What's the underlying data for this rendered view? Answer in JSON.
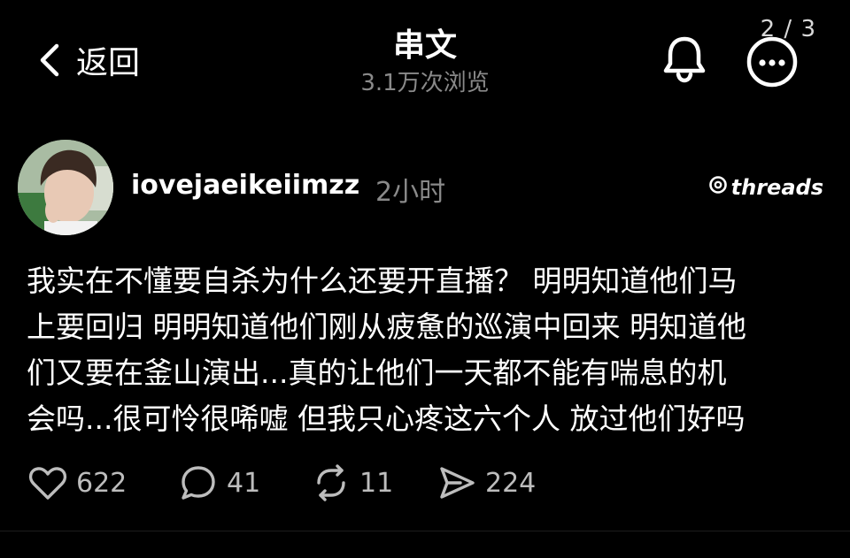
{
  "page_counter": "2 / 3",
  "header": {
    "back_label": "返回",
    "title": "串文",
    "views": "3.1万次浏览"
  },
  "icons": {
    "back": "chevron-left-icon",
    "bell": "bell-icon",
    "more": "more-icon",
    "like": "heart-icon",
    "reply": "comment-icon",
    "repost": "repost-icon",
    "share": "send-icon",
    "brand": "threads-logo"
  },
  "post": {
    "username": "iovejaeikeiimzz",
    "time": "2小时",
    "brand_text": "threads",
    "text_lines": [
      "我实在不懂要自杀为什么还要开直播？ 明明知道他们马",
      "上要回归 明明知道他们刚从疲惫的巡演中回来 明知道他",
      "们又要在釜山演出...真的让他们一天都不能有喘息的机",
      "会吗...很可怜很唏嘘 但我只心疼这六个人 放过他们好吗"
    ]
  },
  "actions": {
    "likes": "622",
    "replies": "41",
    "reposts": "11",
    "shares": "224"
  },
  "colors": {
    "background": "#000000",
    "text": "#ffffff",
    "secondary": "#8a8a8a"
  }
}
